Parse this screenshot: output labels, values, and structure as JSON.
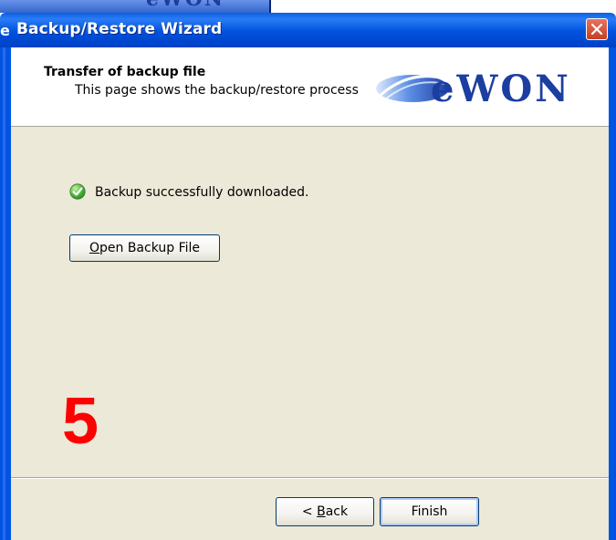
{
  "window": {
    "title": "Backup/Restore Wizard",
    "background_title_fragment": "e"
  },
  "background_window": {
    "logo_text": "eWON",
    "scroll_glyph": "<"
  },
  "header": {
    "title": "Transfer of backup file",
    "subtitle": "This page shows the backup/restore process",
    "logo_text": "eWON"
  },
  "status": {
    "icon": "checkmark-circle-icon",
    "message": "Backup successfully downloaded."
  },
  "open_button": {
    "label_mnemonic": "O",
    "label_rest": "pen Backup File"
  },
  "annotation": {
    "step_number": "5"
  },
  "footer": {
    "back": {
      "prefix": "< ",
      "mnemonic": "B",
      "rest": "ack"
    },
    "finish_label": "Finish"
  },
  "colors": {
    "title_bar": "#0054e3",
    "client_bg": "#ece9d8",
    "annotation": "#ff0000",
    "logo": "#1c3ea0"
  }
}
